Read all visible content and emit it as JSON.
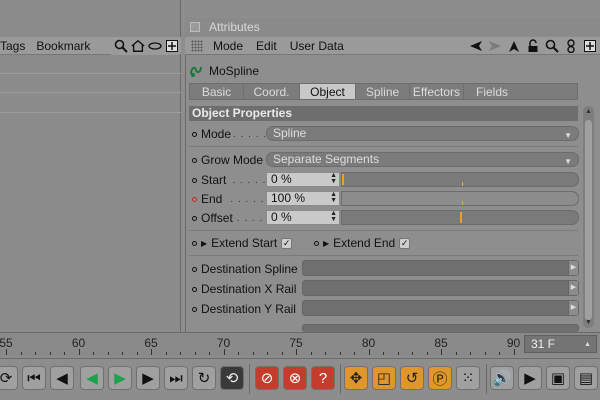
{
  "left_panel": {
    "menu": [
      "Tags",
      "Bookmark"
    ],
    "icons": [
      "magnifier-icon",
      "home-icon",
      "eye-icon",
      "expand-icon"
    ]
  },
  "attributes": {
    "title": "Attributes",
    "menu": [
      "Mode",
      "Edit",
      "User Data"
    ],
    "menu_icons": [
      "back-arrow-icon",
      "forward-arrow-icon",
      "up-arrow-icon",
      "lock-icon",
      "search-icon",
      "settings-icon",
      "expand-icon"
    ],
    "object_name": "MoSpline",
    "tabs": [
      {
        "label": "Basic",
        "active": false
      },
      {
        "label": "Coord.",
        "active": false
      },
      {
        "label": "Object",
        "active": true
      },
      {
        "label": "Spline",
        "active": false
      },
      {
        "label": "Effectors",
        "active": false
      },
      {
        "label": "Fields",
        "active": false
      }
    ],
    "section_title": "Object Properties",
    "mode": {
      "label": "Mode",
      "value": "Spline"
    },
    "grow_mode": {
      "label": "Grow Mode",
      "value": "Separate Segments"
    },
    "start": {
      "label": "Start",
      "value": "0 %",
      "level": 0
    },
    "end": {
      "label": "End",
      "value": "100 %",
      "level": 100
    },
    "offset": {
      "label": "Offset",
      "value": "0 %",
      "level": 0
    },
    "extend_start": {
      "label": "Extend Start",
      "checked": true
    },
    "extend_end": {
      "label": "Extend End",
      "checked": true
    },
    "destination_spline": {
      "label": "Destination Spline"
    },
    "destination_x_rail": {
      "label": "Destination X Rail"
    },
    "destination_y_rail": {
      "label": "Destination Y Rail"
    }
  },
  "timeline": {
    "ticks": [
      "55",
      "60",
      "65",
      "70",
      "75",
      "80",
      "85",
      "90"
    ],
    "current_frame": "31 F"
  },
  "toolbar": {
    "buttons": [
      "go-start-icon",
      "prev-key-icon",
      "prev-frame-icon",
      "play-backward-icon",
      "play-forward-icon",
      "next-frame-icon",
      "next-key-icon",
      "go-end-icon",
      "loop-icon",
      "loop-mode-icon",
      "record-icon",
      "autokey-icon",
      "keyframe-help-icon",
      "move-icon",
      "scale-icon",
      "rotate-icon",
      "param-icon",
      "points-icon",
      "sound-icon",
      "render-view-icon",
      "render-icon",
      "render-settings-icon"
    ]
  }
}
